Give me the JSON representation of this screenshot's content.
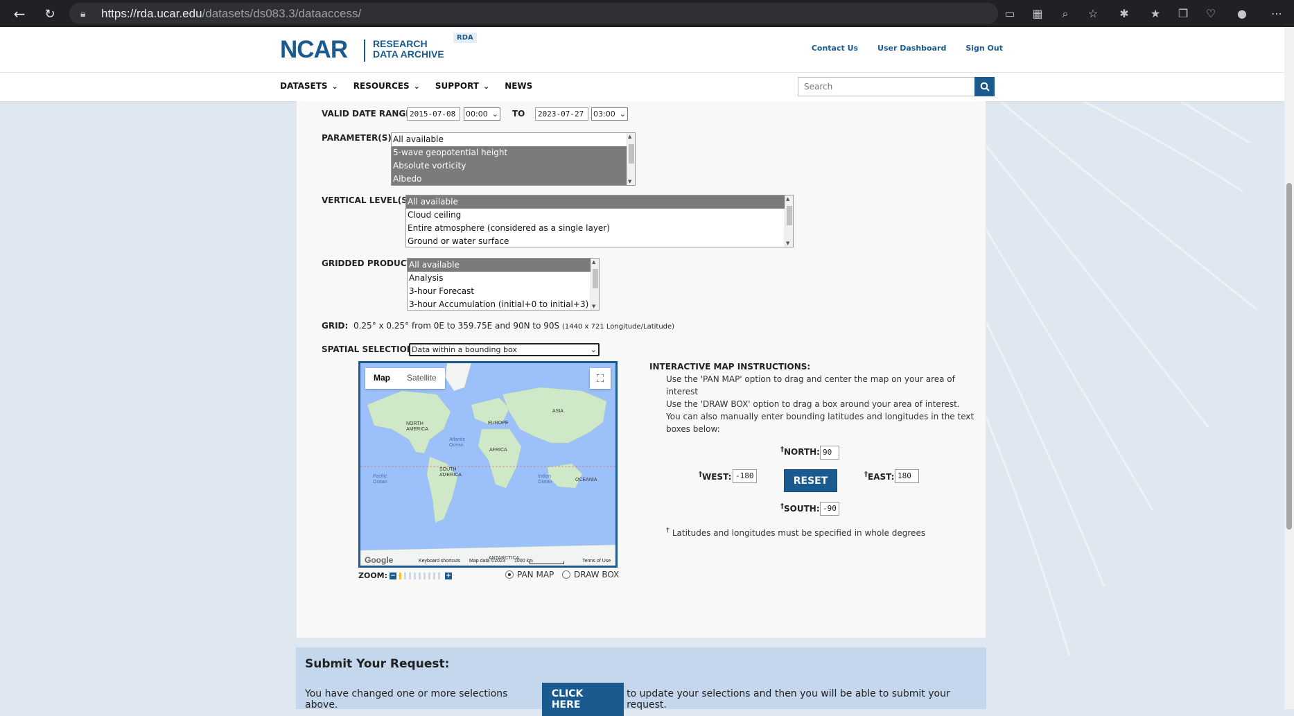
{
  "browser": {
    "url_host": "https://rda.ucar.edu",
    "url_path": "/datasets/ds083.3/dataaccess/"
  },
  "header": {
    "logo_main": "NCAR",
    "logo_sub_line1": "RESEARCH",
    "logo_sub_line2": "DATA ARCHIVE",
    "logo_badge": "RDA",
    "links": [
      "Contact Us",
      "User Dashboard",
      "Sign Out"
    ]
  },
  "nav": {
    "items": [
      "DATASETS",
      "RESOURCES",
      "SUPPORT",
      "NEWS"
    ],
    "search_placeholder": "Search"
  },
  "form": {
    "valid_date_label": "VALID DATE RANGE:",
    "start_date": "2015-07-08",
    "start_time": "00:00",
    "to_label": "TO",
    "end_date": "2023-07-27",
    "end_time": "03:00",
    "parameters_label": "PARAMETER(S):",
    "parameters": [
      "All available",
      "5-wave geopotential height",
      "Absolute vorticity",
      "Albedo"
    ],
    "levels_label": "VERTICAL LEVEL(S):",
    "levels": [
      "All available",
      "Cloud ceiling",
      "Entire atmosphere (considered as a single layer)",
      "Ground or water surface"
    ],
    "product_label": "GRIDDED PRODUCT:",
    "products": [
      "All available",
      "Analysis",
      "3-hour Forecast",
      "3-hour Accumulation (initial+0 to initial+3)"
    ],
    "grid_label": "GRID:",
    "grid_text": "0.25° x 0.25° from 0E to 359.75E and 90N to 90S",
    "grid_small": "(1440 x 721 Longitude/Latitude)",
    "spatial_label": "SPATIAL SELECTION:",
    "spatial_value": "Data within a bounding box"
  },
  "map": {
    "tab_map": "Map",
    "tab_satellite": "Satellite",
    "labels": {
      "north_america": "NORTH AMERICA",
      "europe": "EUROPE",
      "asia": "ASIA",
      "africa": "AFRICA",
      "south_america": "SOUTH AMERICA",
      "oceania": "OCEANIA",
      "atlantic": "Atlantic Ocean",
      "pacific": "Pacific Ocean",
      "indian": "Indian Ocean",
      "antarctica": "ANTARCTICA"
    },
    "footer_shortcuts": "Keyboard shortcuts",
    "footer_data": "Map data ©2023",
    "footer_scale": "1000 km",
    "footer_terms": "Terms of Use",
    "google": "Google",
    "zoom_label": "ZOOM:",
    "pan_label": "PAN MAP",
    "draw_label": "DRAW BOX",
    "pan_selected": true
  },
  "instructions": {
    "title": "INTERACTIVE MAP INSTRUCTIONS:",
    "line1": "Use the 'PAN MAP' option to drag and center the map on your area of interest",
    "line2": "Use the 'DRAW BOX' option to drag a box around your area of interest. You can also manually enter bounding latitudes and longitudes in the text boxes below:",
    "north_label": "NORTH:",
    "north": "90",
    "west_label": "WEST:",
    "west": "-180",
    "east_label": "EAST:",
    "east": "180",
    "south_label": "SOUTH:",
    "south": "-90",
    "reset": "RESET",
    "dagger": "†",
    "note": "Latitudes and longitudes must be specified in whole degrees"
  },
  "submit": {
    "title": "Submit Your Request:",
    "text_before": "You have changed one or more selections above.",
    "button": "CLICK HERE",
    "text_after": "to update your selections and then you will be able to submit your request."
  },
  "colors": {
    "brand_blue": "#1a5a8f",
    "submit_bg": "#c5d7ec",
    "selected_option": "#7b7b7b"
  }
}
